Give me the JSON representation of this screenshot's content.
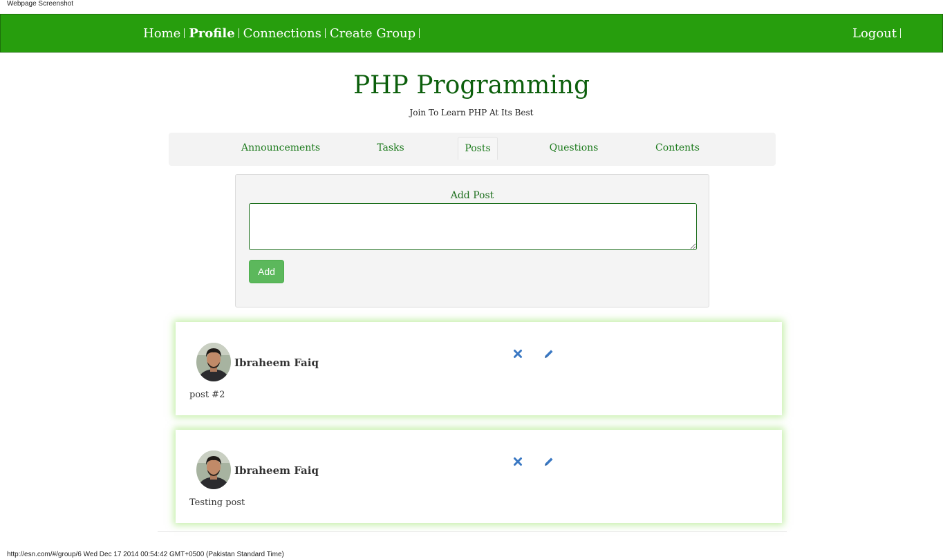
{
  "screenshot_label": "Webpage Screenshot",
  "nav": {
    "items": [
      {
        "label": "Home"
      },
      {
        "label": "Profile"
      },
      {
        "label": "Connections"
      },
      {
        "label": "Create Group"
      }
    ],
    "logout_label": "Logout"
  },
  "group": {
    "title": "PHP Programming",
    "subtitle": "Join To Learn PHP At Its Best"
  },
  "tabs": [
    {
      "label": "Announcements"
    },
    {
      "label": "Tasks"
    },
    {
      "label": "Posts",
      "active": true
    },
    {
      "label": "Questions"
    },
    {
      "label": "Contents"
    }
  ],
  "add_post": {
    "label": "Add Post",
    "textarea_value": "",
    "button_label": "Add"
  },
  "posts": [
    {
      "author": "Ibraheem Faiq",
      "body": "post #2"
    },
    {
      "author": "Ibraheem Faiq",
      "body": "Testing post"
    }
  ],
  "icons": {
    "delete": "close-icon",
    "edit": "pencil-icon"
  },
  "colors": {
    "navbar": "#279e0d",
    "accent_text": "#0c5f0c",
    "add_button": "#5cb85c",
    "action_icon": "#3a78c3"
  },
  "status_bar": "http://esn.com/#/group/6 Wed Dec 17 2014 00:54:42 GMT+0500 (Pakistan Standard Time)"
}
